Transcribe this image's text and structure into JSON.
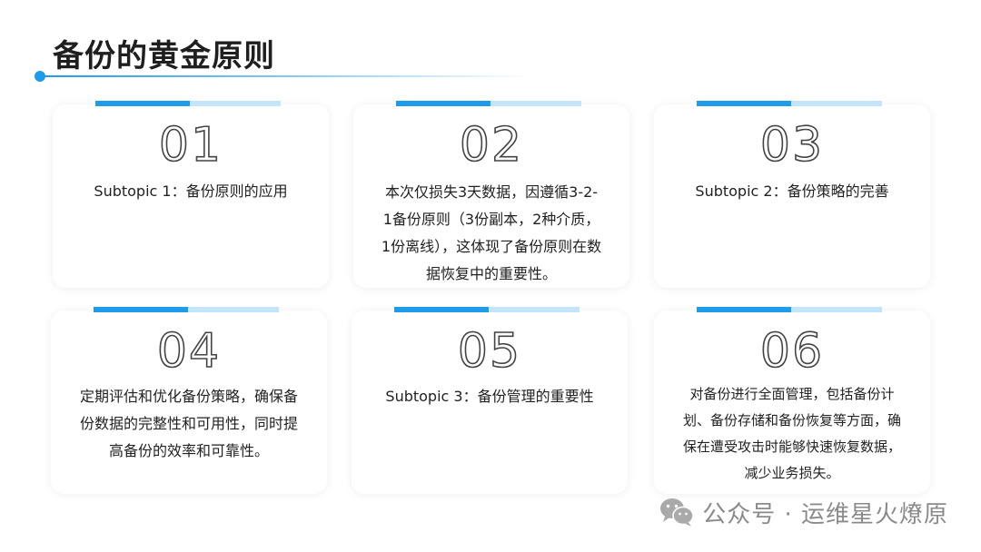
{
  "title": "备份的黄金原则",
  "cards": [
    {
      "num": "01",
      "text": "Subtopic 1：备份原则的应用"
    },
    {
      "num": "02",
      "text": "本次仅损失3天数据，因遵循3-2- 1备份原则（3份副本，2种介质，1份离线），这体现了备份原则在数据恢复中的重要性。"
    },
    {
      "num": "03",
      "text": "Subtopic 2：备份策略的完善"
    },
    {
      "num": "04",
      "text": "定期评估和优化备份策略，确保备份数据的完整性和可用性，同时提高备份的效率和可靠性。"
    },
    {
      "num": "05",
      "text": "Subtopic 3：备份管理的重要性"
    },
    {
      "num": "06",
      "text": "对备份进行全面管理，包括备份计划、备份存储和备份恢复等方面，确保在遭受攻击时能够快速恢复数据，减少业务损失。"
    }
  ],
  "footer": {
    "text": "公众号 · 运维星火燎原",
    "icon": "wechat-icon"
  }
}
